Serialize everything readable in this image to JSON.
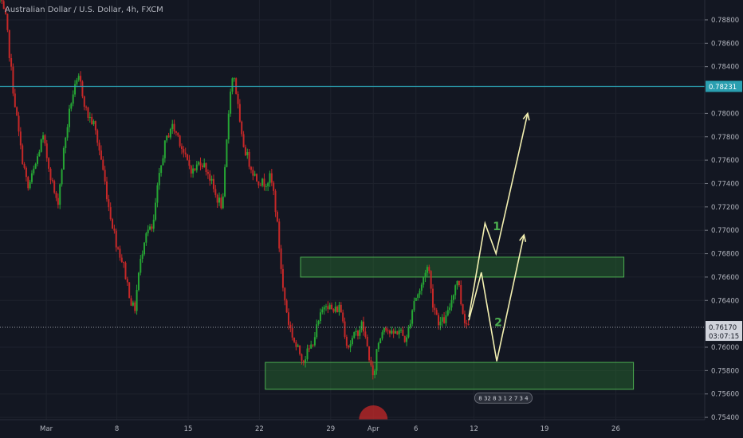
{
  "chart_data": {
    "type": "candlestick",
    "title": "Australian Dollar / U.S. Dollar, 4h, FXCM",
    "ylim": [
      0.7538,
      0.7897
    ],
    "xlim": [
      -63,
      896
    ],
    "y_ticks": [
      "0.78800",
      "0.78600",
      "0.78400",
      "0.78000",
      "0.77800",
      "0.77600",
      "0.77400",
      "0.77200",
      "0.77000",
      "0.76800",
      "0.76600",
      "0.76400",
      "0.76000",
      "0.75800",
      "0.75600",
      "0.75400"
    ],
    "x_ticks": [
      {
        "label": "Mar",
        "x": 0
      },
      {
        "label": "8",
        "x": 96
      },
      {
        "label": "15",
        "x": 193
      },
      {
        "label": "22",
        "x": 290
      },
      {
        "label": "29",
        "x": 387
      },
      {
        "label": "Apr",
        "x": 445
      },
      {
        "label": "6",
        "x": 503
      },
      {
        "label": "12",
        "x": 582
      },
      {
        "label": "19",
        "x": 678
      },
      {
        "label": "26",
        "x": 775
      }
    ],
    "horizontal_line": {
      "value": 0.78231,
      "label": "0.78231",
      "color": "#2a9fb0"
    },
    "current_price": {
      "value": 0.7617,
      "label": "0.76170",
      "countdown": "03:07:15",
      "color": "#9598a1"
    },
    "zones": [
      {
        "name": "resistance",
        "x0": 346,
        "x1": 786,
        "y0": 0.766,
        "y1": 0.7677,
        "color": "#2e7d32"
      },
      {
        "name": "support",
        "x0": 298,
        "x1": 799,
        "y0": 0.7564,
        "y1": 0.7587,
        "color": "#2e7d32"
      }
    ],
    "scenarios": [
      {
        "label": "1",
        "points": [
          [
            575,
            0.7626
          ],
          [
            597,
            0.7706
          ],
          [
            612,
            0.768
          ],
          [
            655,
            0.78
          ]
        ]
      },
      {
        "label": "2",
        "points": [
          [
            575,
            0.7623
          ],
          [
            592,
            0.7664
          ],
          [
            613,
            0.7588
          ],
          [
            650,
            0.7696
          ]
        ]
      }
    ],
    "annotation_text": "8 32 8 3 1 2 7 3 4",
    "close_path": [
      [
        -63,
        0.7897
      ],
      [
        -55,
        0.788
      ],
      [
        -45,
        0.782
      ],
      [
        -35,
        0.777
      ],
      [
        -25,
        0.7735
      ],
      [
        -15,
        0.7755
      ],
      [
        -5,
        0.778
      ],
      [
        5,
        0.775
      ],
      [
        15,
        0.772
      ],
      [
        25,
        0.7775
      ],
      [
        35,
        0.7815
      ],
      [
        45,
        0.783
      ],
      [
        55,
        0.78
      ],
      [
        65,
        0.779
      ],
      [
        75,
        0.776
      ],
      [
        85,
        0.772
      ],
      [
        95,
        0.769
      ],
      [
        105,
        0.767
      ],
      [
        115,
        0.764
      ],
      [
        120,
        0.763
      ],
      [
        125,
        0.766
      ],
      [
        135,
        0.77
      ],
      [
        145,
        0.77
      ],
      [
        150,
        0.773
      ],
      [
        160,
        0.777
      ],
      [
        170,
        0.779
      ],
      [
        180,
        0.778
      ],
      [
        190,
        0.776
      ],
      [
        200,
        0.775
      ],
      [
        210,
        0.776
      ],
      [
        220,
        0.775
      ],
      [
        230,
        0.773
      ],
      [
        240,
        0.772
      ],
      [
        250,
        0.782
      ],
      [
        255,
        0.7835
      ],
      [
        260,
        0.781
      ],
      [
        265,
        0.778
      ],
      [
        275,
        0.776
      ],
      [
        285,
        0.7745
      ],
      [
        295,
        0.774
      ],
      [
        305,
        0.7745
      ],
      [
        310,
        0.773
      ],
      [
        315,
        0.77
      ],
      [
        322,
        0.765
      ],
      [
        330,
        0.762
      ],
      [
        340,
        0.76
      ],
      [
        350,
        0.759
      ],
      [
        360,
        0.76
      ],
      [
        370,
        0.762
      ],
      [
        380,
        0.764
      ],
      [
        390,
        0.763
      ],
      [
        400,
        0.7635
      ],
      [
        410,
        0.76
      ],
      [
        420,
        0.761
      ],
      [
        430,
        0.762
      ],
      [
        440,
        0.759
      ],
      [
        445,
        0.757
      ],
      [
        450,
        0.76
      ],
      [
        460,
        0.762
      ],
      [
        470,
        0.761
      ],
      [
        480,
        0.7615
      ],
      [
        490,
        0.7605
      ],
      [
        500,
        0.764
      ],
      [
        510,
        0.765
      ],
      [
        515,
        0.7665
      ],
      [
        520,
        0.767
      ],
      [
        525,
        0.764
      ],
      [
        535,
        0.762
      ],
      [
        545,
        0.7625
      ],
      [
        555,
        0.765
      ],
      [
        560,
        0.766
      ],
      [
        565,
        0.7635
      ],
      [
        570,
        0.7622
      ],
      [
        575,
        0.7619
      ]
    ]
  }
}
